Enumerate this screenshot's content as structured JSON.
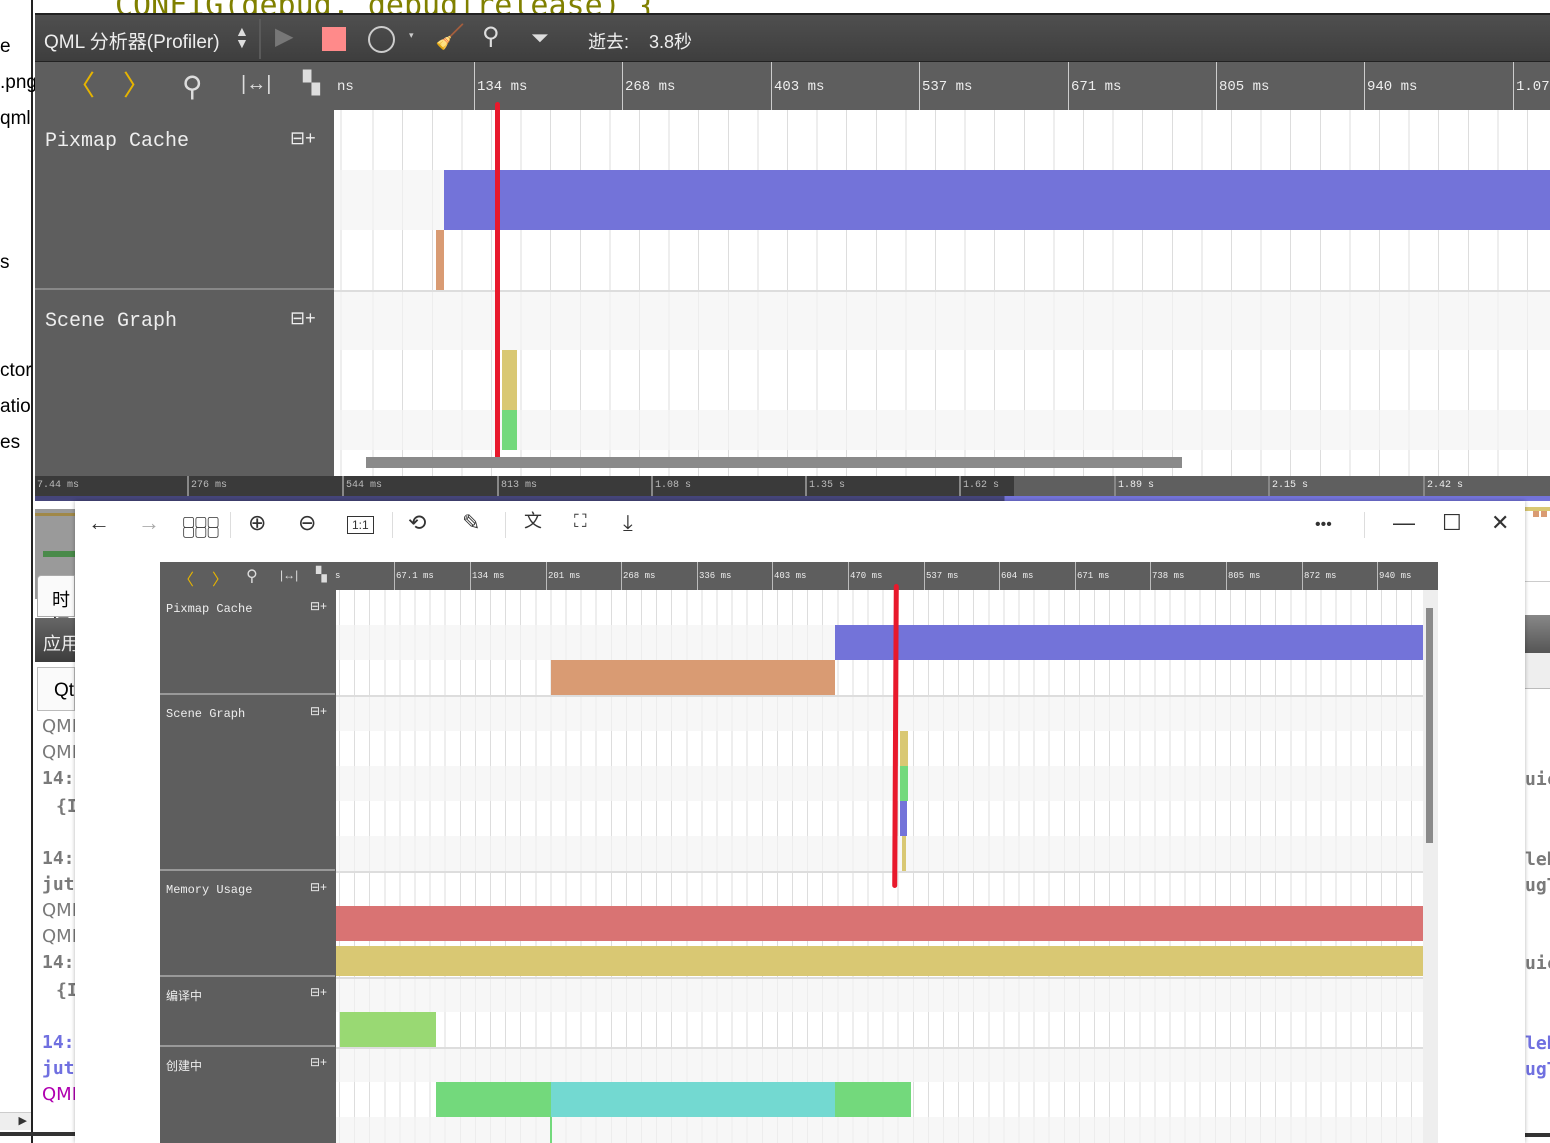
{
  "background": {
    "code_line": "CONFIG(debug, debug|release) {",
    "left_fragments": [
      "e",
      ".png",
      "qml",
      "s",
      "ctor",
      "atio",
      "es"
    ],
    "tab_time": "时间",
    "panel_title": "应用",
    "panel_tab": "Qt",
    "log_lines": [
      "QML",
      "QML",
      "14:",
      "{I",
      "14:",
      "jut",
      "QML",
      "QML",
      "14:",
      "{I",
      "14:",
      "jut",
      "QML"
    ],
    "right_fragments": [
      "uic",
      "leb",
      "ugT",
      "uic",
      "leb",
      "ugT"
    ]
  },
  "toolbar": {
    "mode_select": "QML 分析器(Profiler)",
    "elapsed_label": "逝去:",
    "elapsed_value": "3.8秒",
    "icons": [
      "start-icon",
      "stop-icon",
      "record-icon",
      "clear-icon",
      "search-icon",
      "filter-icon"
    ]
  },
  "timeline": {
    "ruler_labels": [
      "ns",
      "134 ms",
      "268 ms",
      "403 ms",
      "537 ms",
      "671 ms",
      "805 ms",
      "940 ms",
      "1.07"
    ],
    "tracks": [
      "Pixmap Cache",
      "Scene Graph"
    ],
    "overview_labels": [
      "7.44 ms",
      "276 ms",
      "544 ms",
      "813 ms",
      "1.08 s",
      "1.35 s",
      "1.62 s",
      "1.89 s",
      "2.15 s",
      "2.42 s"
    ]
  },
  "viewer": {
    "toolbar_icons": [
      "back-icon",
      "forward-icon",
      "grid-icon",
      "zoom-in-icon",
      "zoom-out-icon",
      "actual-size-icon",
      "rotate-icon",
      "edit-icon",
      "translate-icon",
      "ocr-icon",
      "save-icon",
      "more-icon",
      "minimize-icon",
      "maximize-icon",
      "close-icon"
    ],
    "more": "•••",
    "inner_ruler_labels": [
      "s",
      "67.1 ms",
      "134 ms",
      "201 ms",
      "268 ms",
      "336 ms",
      "403 ms",
      "470 ms",
      "537 ms",
      "604 ms",
      "671 ms",
      "738 ms",
      "805 ms",
      "872 ms",
      "940 ms"
    ],
    "inner_tracks": [
      "Pixmap Cache",
      "Scene Graph",
      "Memory Usage",
      "编译中",
      "创建中"
    ]
  },
  "colors": {
    "pixmap_blue": "#7373d9",
    "pixmap_orange": "#d99b73",
    "memory_red": "#d97373",
    "memory_yellow": "#d9c873",
    "compile_green": "#99d973",
    "create_green": "#73d97c",
    "create_cyan": "#73d9d1",
    "cursor_red": "#e8192c",
    "accent_yellow": "#e6b400"
  }
}
